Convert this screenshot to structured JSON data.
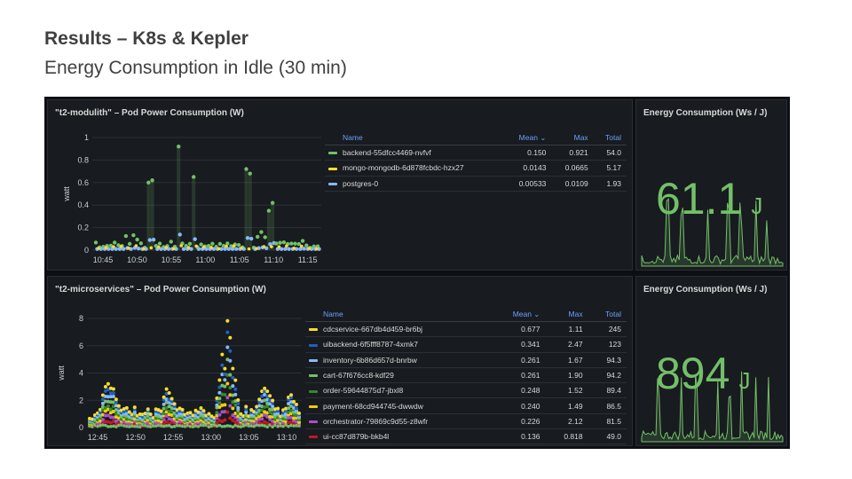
{
  "slide": {
    "title": "Results – K8s & Kepler",
    "subtitle": "Energy Consumption in Idle (30 min)"
  },
  "panels": {
    "modulith": {
      "title": "\"t2-modulith\" – Pod Power Consumption (W)",
      "ylabel": "watt",
      "yticks": [
        "0",
        "0.2",
        "0.4",
        "0.6",
        "0.8",
        "1"
      ],
      "xticks": [
        "10:45",
        "10:50",
        "10:55",
        "11:00",
        "11:05",
        "11:10",
        "11:15"
      ],
      "legend": {
        "headers": [
          "Name",
          "Mean ⌄",
          "Max",
          "Total"
        ],
        "rows": [
          {
            "name": "backend-55dfcc4469-nvfvf",
            "mean": "0.150",
            "max": "0.921",
            "total": "54.0",
            "color": "#73bf69"
          },
          {
            "name": "mongo-mongodb-6d878fcbdc-hzx27",
            "mean": "0.0143",
            "max": "0.0665",
            "total": "5.17",
            "color": "#fade2a"
          },
          {
            "name": "postgres-0",
            "mean": "0.00533",
            "max": "0.0109",
            "total": "1.93",
            "color": "#8ab8ff"
          }
        ]
      }
    },
    "modulith_energy": {
      "title": "Energy Consumption (Ws / J)",
      "value": "61.1",
      "unit": "J"
    },
    "micro": {
      "title": "\"t2-microservices\" – Pod Power Consumption (W)",
      "ylabel": "watt",
      "yticks": [
        "0",
        "2",
        "4",
        "6",
        "8"
      ],
      "xticks": [
        "12:45",
        "12:50",
        "12:55",
        "13:00",
        "13:05",
        "13:10"
      ],
      "legend": {
        "headers": [
          "Name",
          "Mean ⌄",
          "Max",
          "Total"
        ],
        "rows": [
          {
            "name": "cdcservice-667db4d459-br6bj",
            "mean": "0.677",
            "max": "1.11",
            "total": "245",
            "color": "#fade2a"
          },
          {
            "name": "uibackend-6f5fff8787-4xmk7",
            "mean": "0.341",
            "max": "2.47",
            "total": "123",
            "color": "#1f60c4"
          },
          {
            "name": "inventory-6b86d657d-bnrbw",
            "mean": "0.261",
            "max": "1.67",
            "total": "94.3",
            "color": "#8ab8ff"
          },
          {
            "name": "cart-67f676cc8-kdf29",
            "mean": "0.261",
            "max": "1.90",
            "total": "94.2",
            "color": "#73bf69"
          },
          {
            "name": "order-59644875d7-jbxl8",
            "mean": "0.248",
            "max": "1.52",
            "total": "89.4",
            "color": "#37872d"
          },
          {
            "name": "payment-68cd944745-dwwdw",
            "mean": "0.240",
            "max": "1.49",
            "total": "86.5",
            "color": "#f2cc0c"
          },
          {
            "name": "orchestrator-79869c9d55-z8wfr",
            "mean": "0.226",
            "max": "2.12",
            "total": "81.5",
            "color": "#a352cc"
          },
          {
            "name": "ui-cc87d879b-bkb4l",
            "mean": "0.136",
            "max": "0.818",
            "total": "49.0",
            "color": "#c4162a"
          }
        ]
      }
    },
    "micro_energy": {
      "title": "Energy Consumption (Ws / J)",
      "value": "894",
      "unit": "J"
    }
  }
}
